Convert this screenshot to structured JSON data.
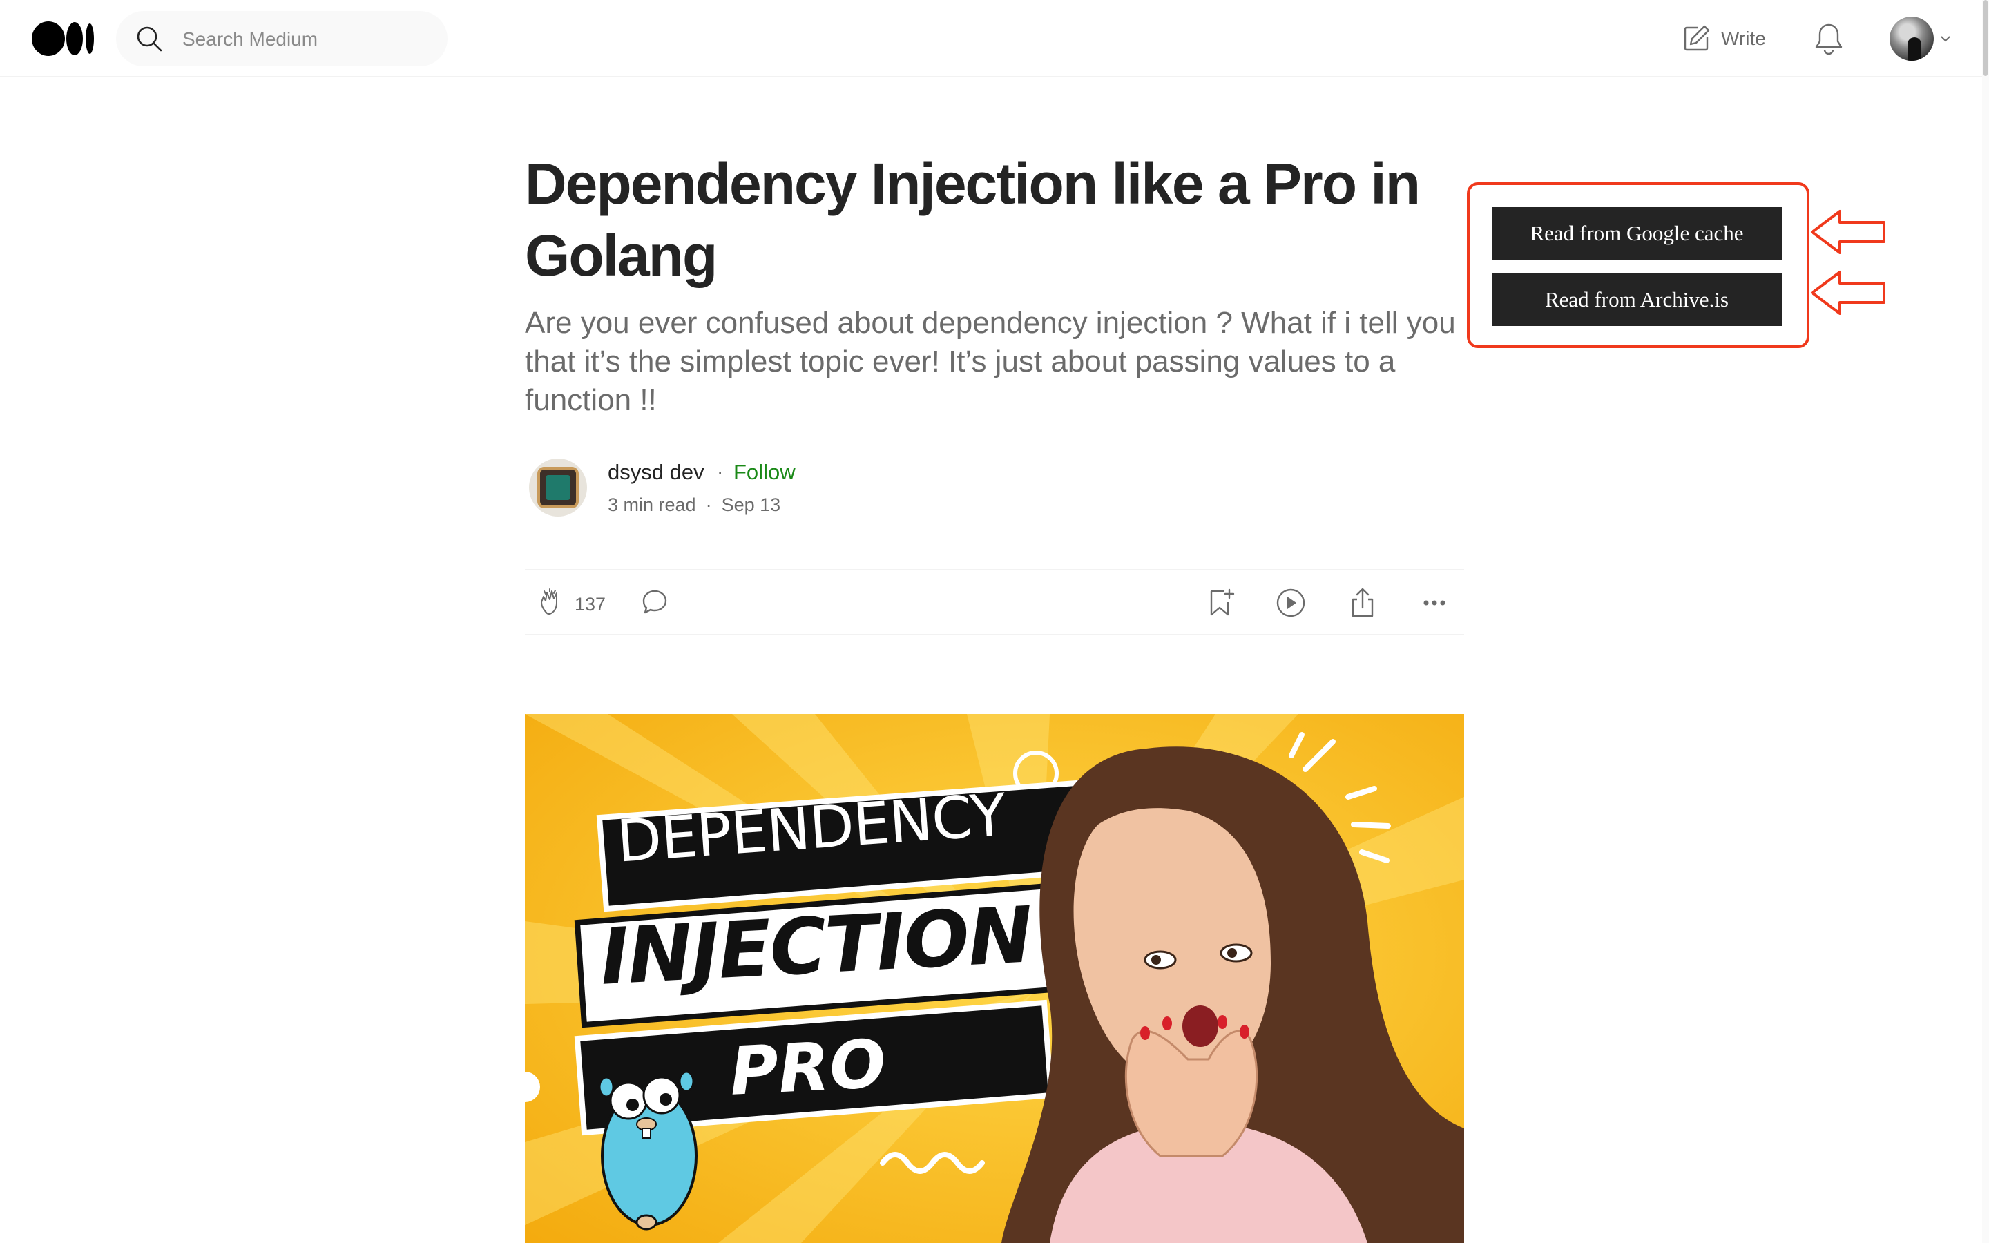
{
  "header": {
    "search_placeholder": "Search Medium",
    "write_label": "Write",
    "icons": {
      "logo": "medium-logo",
      "search": "search-icon",
      "write": "write-icon",
      "notifications": "bell-icon",
      "avatar_menu": "chevron-down-icon"
    }
  },
  "article": {
    "title": "Dependency Injection like a Pro in Golang",
    "subtitle": "Are you ever confused about dependency injection ? What if i tell you that it’s the simplest topic ever! It’s just about passing values to a function !!",
    "author": {
      "name": "dsysd dev",
      "separator": "·",
      "follow_label": "Follow",
      "read_time": "3 min read",
      "date": "Sep 13"
    },
    "actions": {
      "clap_count": "137",
      "icons": [
        "clap-icon",
        "response-icon",
        "bookmark-icon",
        "listen-icon",
        "share-icon",
        "more-icon"
      ]
    },
    "hero_image": {
      "line1": "DEPENDENCY",
      "line2": "INJECTION",
      "line3": "PRO"
    }
  },
  "overlay": {
    "google_cache_label": "Read from Google cache",
    "archive_label": "Read from Archive.is",
    "accent_color": "#f0391c"
  },
  "colors": {
    "text": "#242424",
    "muted": "#6b6b6b",
    "follow": "#1a8917",
    "hero_bg": "#f6b814"
  }
}
